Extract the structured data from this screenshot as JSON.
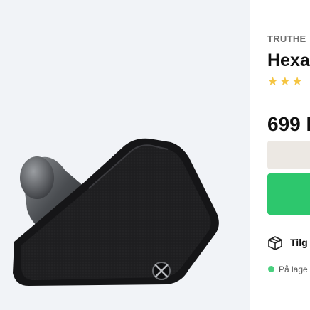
{
  "product": {
    "brand": "TRUTHE",
    "title": "Hexa",
    "rating_stars": 3,
    "price": "699 I",
    "availability": "Tilg",
    "stock": "På lage"
  },
  "colors": {
    "buy_button": "#2dc76d",
    "variant_button": "#ece8e3",
    "star": "#f5c542",
    "in_stock_dot": "#4ad07f",
    "image_bg": "#f1f3f7"
  },
  "icons": {
    "availability": "box-icon",
    "stock": "green-dot-icon",
    "rating": "star-icon"
  }
}
